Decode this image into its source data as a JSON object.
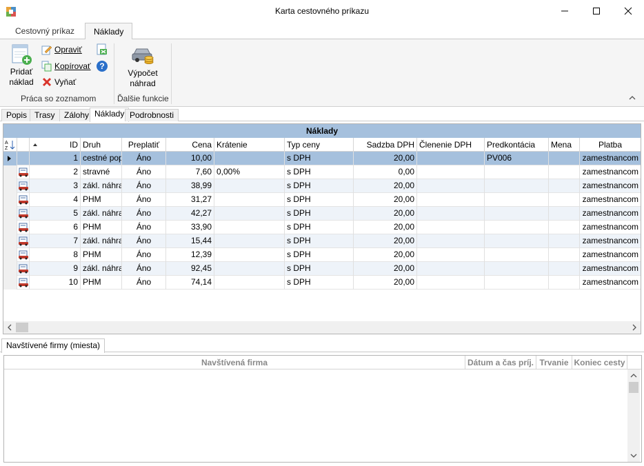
{
  "window": {
    "title": "Karta cestovného príkazu"
  },
  "ribbon": {
    "tabs": [
      "Cestovný príkaz",
      "Náklady"
    ],
    "add_cost": "Pridať náklad",
    "edit": "Opraviť",
    "copy": "Kopírovať",
    "remove": "Vyňať",
    "group_list": "Práca so zoznamom",
    "calc": "Výpočet náhrad",
    "group_other": "Ďalšie funkcie"
  },
  "page_tabs": [
    "Popis",
    "Trasy",
    "Zálohy",
    "Náklady",
    "Podrobnosti"
  ],
  "costs_grid": {
    "caption": "Náklady",
    "columns": [
      "ID",
      "Druh",
      "Preplatiť",
      "Cena",
      "Krátenie",
      "Typ ceny",
      "Sadzba DPH",
      "Členenie DPH",
      "Predkontácia",
      "Mena",
      "Platba"
    ],
    "rows": [
      {
        "id": "1",
        "druh": "cestné popla",
        "preplatit": "Áno",
        "cena": "10,00",
        "kratenie": "",
        "typ": "s DPH",
        "sadzba": "20,00",
        "clenenie": "",
        "predkontacia": "PV006",
        "mena": "",
        "platba": "zamestnancom"
      },
      {
        "id": "2",
        "druh": "stravné",
        "preplatit": "Áno",
        "cena": "7,60",
        "kratenie": "0,00%",
        "typ": "s DPH",
        "sadzba": "0,00",
        "clenenie": "",
        "predkontacia": "",
        "mena": "",
        "platba": "zamestnancom"
      },
      {
        "id": "3",
        "druh": "zákl. náhrad",
        "preplatit": "Áno",
        "cena": "38,99",
        "kratenie": "",
        "typ": "s DPH",
        "sadzba": "20,00",
        "clenenie": "",
        "predkontacia": "",
        "mena": "",
        "platba": "zamestnancom"
      },
      {
        "id": "4",
        "druh": "PHM",
        "preplatit": "Áno",
        "cena": "31,27",
        "kratenie": "",
        "typ": "s DPH",
        "sadzba": "20,00",
        "clenenie": "",
        "predkontacia": "",
        "mena": "",
        "platba": "zamestnancom"
      },
      {
        "id": "5",
        "druh": "zákl. náhrad",
        "preplatit": "Áno",
        "cena": "42,27",
        "kratenie": "",
        "typ": "s DPH",
        "sadzba": "20,00",
        "clenenie": "",
        "predkontacia": "",
        "mena": "",
        "platba": "zamestnancom"
      },
      {
        "id": "6",
        "druh": "PHM",
        "preplatit": "Áno",
        "cena": "33,90",
        "kratenie": "",
        "typ": "s DPH",
        "sadzba": "20,00",
        "clenenie": "",
        "predkontacia": "",
        "mena": "",
        "platba": "zamestnancom"
      },
      {
        "id": "7",
        "druh": "zákl. náhrad",
        "preplatit": "Áno",
        "cena": "15,44",
        "kratenie": "",
        "typ": "s DPH",
        "sadzba": "20,00",
        "clenenie": "",
        "predkontacia": "",
        "mena": "",
        "platba": "zamestnancom"
      },
      {
        "id": "8",
        "druh": "PHM",
        "preplatit": "Áno",
        "cena": "12,39",
        "kratenie": "",
        "typ": "s DPH",
        "sadzba": "20,00",
        "clenenie": "",
        "predkontacia": "",
        "mena": "",
        "platba": "zamestnancom"
      },
      {
        "id": "9",
        "druh": "zákl. náhrad",
        "preplatit": "Áno",
        "cena": "92,45",
        "kratenie": "",
        "typ": "s DPH",
        "sadzba": "20,00",
        "clenenie": "",
        "predkontacia": "",
        "mena": "",
        "platba": "zamestnancom"
      },
      {
        "id": "10",
        "druh": "PHM",
        "preplatit": "Áno",
        "cena": "74,14",
        "kratenie": "",
        "typ": "s DPH",
        "sadzba": "20,00",
        "clenenie": "",
        "predkontacia": "",
        "mena": "",
        "platba": "zamestnancom"
      }
    ]
  },
  "bottom": {
    "tab": "Navštívené firmy (miesta)",
    "columns": [
      "Navštívená firma",
      "Dátum a čas príj.",
      "Trvanie",
      "Koniec cesty"
    ]
  },
  "icons": [
    "app-icon",
    "add-icon",
    "edit-icon",
    "copy-icon",
    "delete-icon",
    "export-icon",
    "help-icon",
    "car-coins-icon",
    "sort-icon",
    "row-car-icon",
    "chevron-up-icon"
  ]
}
